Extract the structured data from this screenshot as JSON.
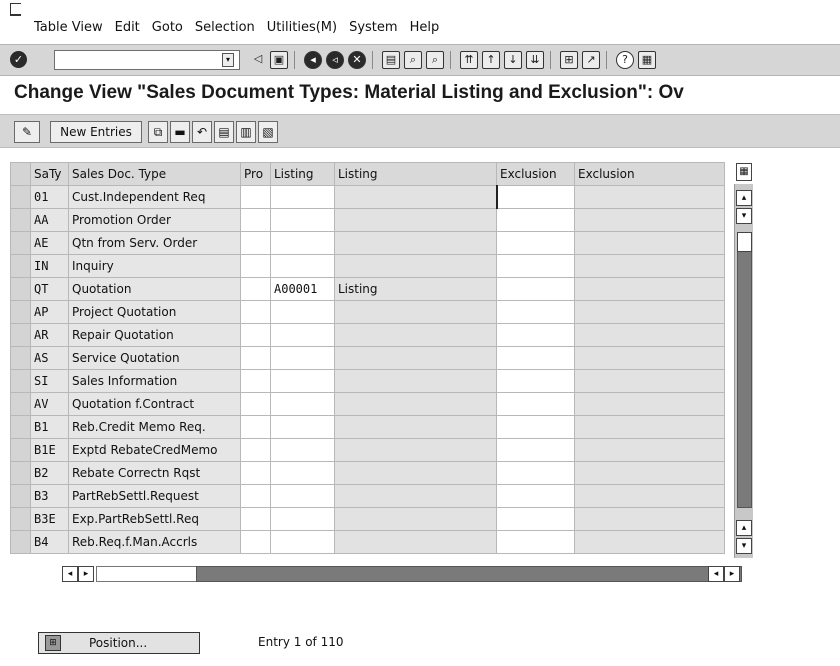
{
  "menubar": {
    "items": [
      "Table View",
      "Edit",
      "Goto",
      "Selection",
      "Utilities(M)",
      "System",
      "Help"
    ]
  },
  "toolbar": {
    "command_field_value": "",
    "icons": [
      "enter-icon",
      "back-arrow-icon",
      "save-icon",
      "back-icon",
      "exit-icon",
      "cancel-icon",
      "print-icon",
      "find-icon",
      "find-next-icon",
      "first-page-icon",
      "previous-page-icon",
      "next-page-icon",
      "last-page-icon",
      "create-session-icon",
      "shortcut-icon",
      "help-icon",
      "customize-layout-icon"
    ]
  },
  "title": "Change View \"Sales Document Types: Material Listing and Exclusion\": Ov",
  "app_toolbar": {
    "new_entries_label": "New Entries"
  },
  "table": {
    "columns": [
      "SaTy",
      "Sales Doc. Type",
      "Pro",
      "Listing",
      "Listing",
      "Exclusion",
      "Exclusion"
    ],
    "rows": [
      {
        "saty": "01",
        "type": "Cust.Independent Req",
        "pro": "",
        "listing": "",
        "listing_desc": "",
        "exclusion": "",
        "exclusion_desc": ""
      },
      {
        "saty": "AA",
        "type": "Promotion Order",
        "pro": "",
        "listing": "",
        "listing_desc": "",
        "exclusion": "",
        "exclusion_desc": ""
      },
      {
        "saty": "AE",
        "type": "Qtn from Serv. Order",
        "pro": "",
        "listing": "",
        "listing_desc": "",
        "exclusion": "",
        "exclusion_desc": ""
      },
      {
        "saty": "IN",
        "type": "Inquiry",
        "pro": "",
        "listing": "",
        "listing_desc": "",
        "exclusion": "",
        "exclusion_desc": ""
      },
      {
        "saty": "QT",
        "type": "Quotation",
        "pro": "",
        "listing": "A00001",
        "listing_desc": "Listing",
        "exclusion": "",
        "exclusion_desc": ""
      },
      {
        "saty": "AP",
        "type": "Project Quotation",
        "pro": "",
        "listing": "",
        "listing_desc": "",
        "exclusion": "",
        "exclusion_desc": ""
      },
      {
        "saty": "AR",
        "type": "Repair Quotation",
        "pro": "",
        "listing": "",
        "listing_desc": "",
        "exclusion": "",
        "exclusion_desc": ""
      },
      {
        "saty": "AS",
        "type": "Service Quotation",
        "pro": "",
        "listing": "",
        "listing_desc": "",
        "exclusion": "",
        "exclusion_desc": ""
      },
      {
        "saty": "SI",
        "type": "Sales Information",
        "pro": "",
        "listing": "",
        "listing_desc": "",
        "exclusion": "",
        "exclusion_desc": ""
      },
      {
        "saty": "AV",
        "type": "Quotation f.Contract",
        "pro": "",
        "listing": "",
        "listing_desc": "",
        "exclusion": "",
        "exclusion_desc": ""
      },
      {
        "saty": "B1",
        "type": "Reb.Credit Memo Req.",
        "pro": "",
        "listing": "",
        "listing_desc": "",
        "exclusion": "",
        "exclusion_desc": ""
      },
      {
        "saty": "B1E",
        "type": "Exptd RebateCredMemo",
        "pro": "",
        "listing": "",
        "listing_desc": "",
        "exclusion": "",
        "exclusion_desc": ""
      },
      {
        "saty": "B2",
        "type": "Rebate Correctn Rqst",
        "pro": "",
        "listing": "",
        "listing_desc": "",
        "exclusion": "",
        "exclusion_desc": ""
      },
      {
        "saty": "B3",
        "type": "PartRebSettl.Request",
        "pro": "",
        "listing": "",
        "listing_desc": "",
        "exclusion": "",
        "exclusion_desc": ""
      },
      {
        "saty": "B3E",
        "type": "Exp.PartRebSettl.Req",
        "pro": "",
        "listing": "",
        "listing_desc": "",
        "exclusion": "",
        "exclusion_desc": ""
      },
      {
        "saty": "B4",
        "type": "Reb.Req.f.Man.Accrls",
        "pro": "",
        "listing": "",
        "listing_desc": "",
        "exclusion": "",
        "exclusion_desc": ""
      }
    ]
  },
  "footer": {
    "position_label": "Position...",
    "entry_text": "Entry 1 of 110"
  }
}
